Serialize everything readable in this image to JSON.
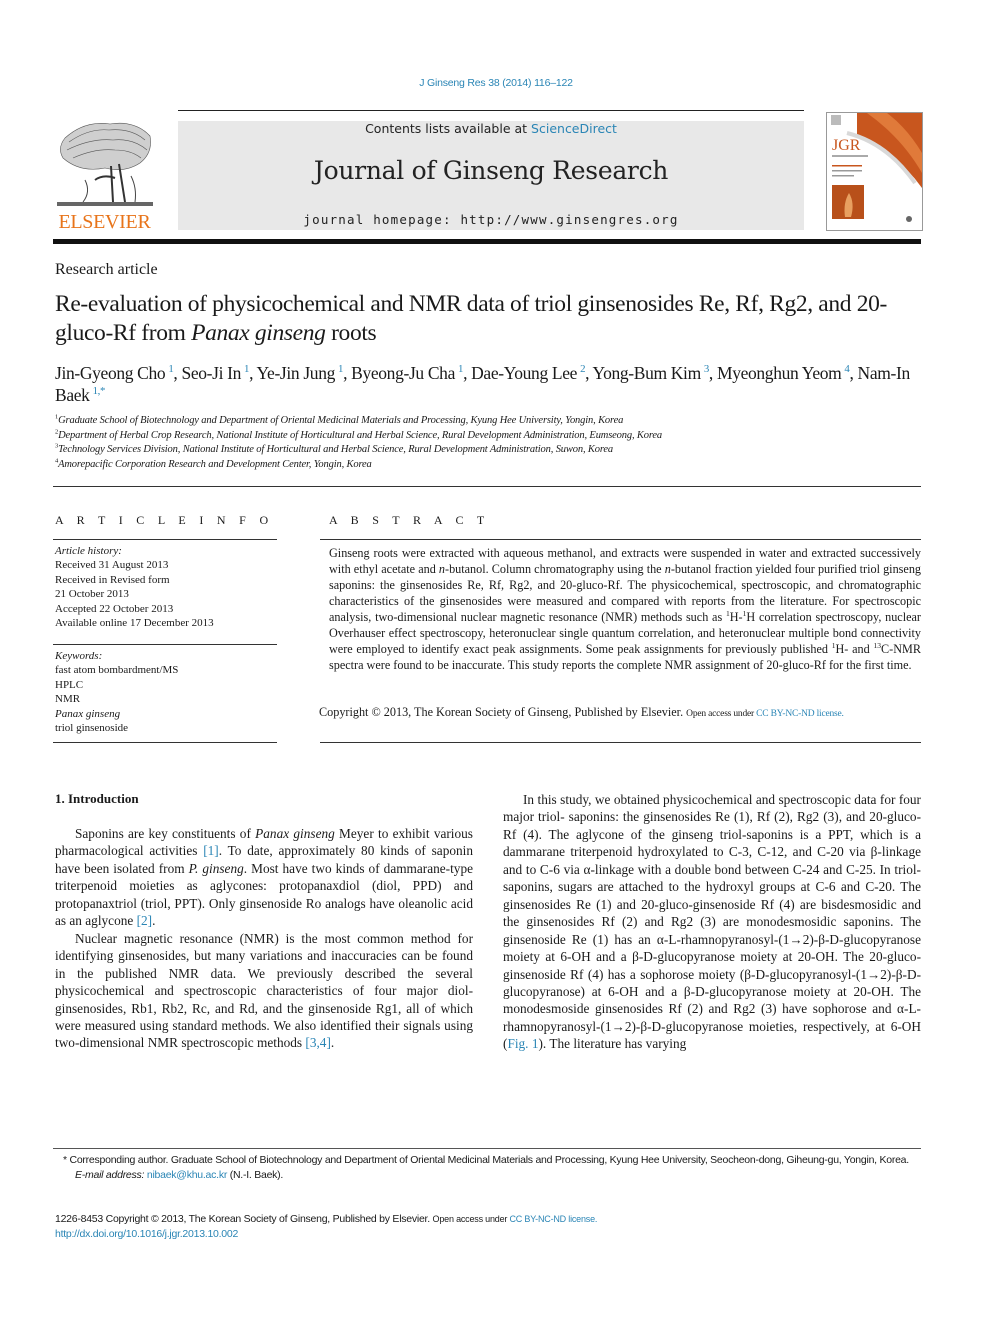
{
  "header": {
    "citation": "J Ginseng Res 38 (2014) 116–122",
    "publisher_logo_text": "ELSEVIER",
    "contents_prefix": "Contents lists available at ",
    "contents_link": "ScienceDirect",
    "journal_title": "Journal of Ginseng Research",
    "homepage_prefix": "journal homepage: ",
    "homepage_url": "http://www.ginsengres.org",
    "cover_label": "JGR",
    "colors": {
      "link": "#2a85b5",
      "elsevier_orange": "#e8741a",
      "banner_bg": "#e8e8e8",
      "cover_orange": "#c8561e"
    }
  },
  "article": {
    "type": "Research article",
    "title_part1": "Re-evaluation of physicochemical and NMR data of triol ginsenosides Re, Rf, Rg2, and 20-gluco-Rf from ",
    "title_italic": "Panax ginseng",
    "title_part2": " roots",
    "authors": [
      {
        "name": "Jin-Gyeong Cho",
        "aff": "1",
        "sep": ", "
      },
      {
        "name": "Seo-Ji In",
        "aff": "1",
        "sep": ", "
      },
      {
        "name": "Ye-Jin Jung",
        "aff": "1",
        "sep": ", "
      },
      {
        "name": "Byeong-Ju Cha",
        "aff": "1",
        "sep": ", "
      },
      {
        "name": "Dae-Young Lee",
        "aff": "2",
        "sep": ", "
      },
      {
        "name": "Yong-Bum Kim",
        "aff": "3",
        "sep": ", "
      },
      {
        "name": "Myeonghun Yeom",
        "aff": "4",
        "sep": ", "
      },
      {
        "name": "Nam-In Baek",
        "aff": "1,*",
        "sep": ""
      }
    ],
    "affiliations": [
      {
        "num": "1",
        "text": "Graduate School of Biotechnology and Department of Oriental Medicinal Materials and Processing, Kyung Hee University, Yongin, Korea"
      },
      {
        "num": "2",
        "text": "Department of Herbal Crop Research, National Institute of Horticultural and Herbal Science, Rural Development Administration, Eumseong, Korea"
      },
      {
        "num": "3",
        "text": "Technology Services Division, National Institute of Horticultural and Herbal Science, Rural Development Administration, Suwon, Korea"
      },
      {
        "num": "4",
        "text": "Amorepacific Corporation Research and Development Center, Yongin, Korea"
      }
    ]
  },
  "article_info": {
    "heading": "A R T I C L E   I N F O",
    "history_label": "Article history:",
    "history": [
      "Received 31 August 2013",
      "Received in Revised form",
      "21 October 2013",
      "Accepted 22 October 2013",
      "Available online 17 December 2013"
    ],
    "keywords_label": "Keywords:",
    "keywords": [
      {
        "text": "fast atom bombardment/MS",
        "italic": false
      },
      {
        "text": "HPLC",
        "italic": false
      },
      {
        "text": "NMR",
        "italic": false
      },
      {
        "text": "Panax ginseng",
        "italic": true
      },
      {
        "text": "triol ginsenoside",
        "italic": false
      }
    ]
  },
  "abstract": {
    "heading": "A B S T R A C T",
    "s1": "Ginseng roots were extracted with aqueous methanol, and extracts were suspended in water and extracted successively with ethyl acetate and ",
    "n1": "n",
    "s2": "-butanol. Column chromatography using the ",
    "n2": "n",
    "s3": "-butanol fraction yielded four purified triol ginseng saponins: the ginsenosides Re, Rf, Rg2, and 20-gluco-Rf. The physicochemical, spectroscopic, and chromatographic characteristics of the ginsenosides were measured and compared with reports from the literature. For spectroscopic analysis, two-dimensional nuclear magnetic resonance (NMR) methods such as ",
    "sup1": "1",
    "s4": "H-",
    "sup2": "1",
    "s5": "H correlation spectroscopy, nuclear Overhauser effect spectroscopy, heteronuclear single quantum correlation, and heteronuclear multiple bond connectivity were employed to identify exact peak assignments. Some peak assignments for previously published ",
    "sup3": "1",
    "s6": "H- and ",
    "sup4": "13",
    "s7": "C-NMR spectra were found to be inaccurate. This study reports the complete NMR assignment of 20-gluco-Rf for the first time.",
    "copyright": "Copyright © 2013, The Korean Society of Ginseng, Published by Elsevier. ",
    "open_access": "Open access under ",
    "license": "CC BY-NC-ND license."
  },
  "body": {
    "section_heading": "1.  Introduction",
    "left": {
      "p1_a": "Saponins are key constituents of ",
      "p1_i1": "Panax ginseng",
      "p1_b": " Meyer to exhibit various pharmacological activities ",
      "p1_ref1": "[1]",
      "p1_c": ". To date, approximately 80 kinds of saponin have been isolated from ",
      "p1_i2": "P. ginseng",
      "p1_d": ". Most have two kinds of dammarane-type triterpenoid moieties as aglycones: protopanaxdiol (diol, PPD) and protopanaxtriol (triol, PPT). Only ginsenoside Ro analogs have oleanolic acid as an aglycone ",
      "p1_ref2": "[2]",
      "p1_e": ".",
      "p2_a": "Nuclear magnetic resonance (NMR) is the most common method for identifying ginsenosides, but many variations and inaccuracies can be found in the published NMR data. We previously described the several physicochemical and spectroscopic characteristics of four major diol-ginsenosides, Rb1, Rb2, Rc, and Rd, and the ginsenoside Rg1, all of which were measured using standard methods. We also identified their signals using two-dimensional NMR spectroscopic methods ",
      "p2_ref": "[3,4]",
      "p2_b": "."
    },
    "right": {
      "p_a": "In this study, we obtained physicochemical and spectroscopic data for four major triol- saponins: the ginsenosides Re (1), Rf (2), Rg2 (3), and 20-gluco-Rf (4). The aglycone of the ginseng triol-saponins is a PPT, which is a dammarane triterpenoid hydroxylated to C-3, C-12, and C-20 via β-linkage and to C-6 via α-linkage with a double bond between C-24 and C-25. In triol-saponins, sugars are attached to the hydroxyl groups at C-6 and C-20. The ginsenosides Re (1) and 20-gluco-ginsenoside Rf (4) are bisdesmosidic and the ginsenosides Rf (2) and Rg2 (3) are monodesmosidic saponins. The ginsenoside Re (1) has an α-L-rhamnopyranosyl-(1→2)-β-D-glucopyranose moiety at 6-OH and a β-D-glucopyranose moiety at 20-OH. The 20-gluco-ginsenoside Rf (4) has a sophorose moiety (β-D-glucopyranosyl-(1→2)-β-D-glucopyranose) at 6-OH and a β-D-glucopyranose moiety at 20-OH. The monodesmoside ginsenosides Rf (2) and Rg2 (3) have sophorose and α-L-rhamnopyranosyl-(1→2)-β-D-glucopyranose moieties, respectively, at 6-OH (",
      "p_ref": "Fig. 1",
      "p_b": "). The literature has varying"
    }
  },
  "footnotes": {
    "corresponding": "* Corresponding author. Graduate School of Biotechnology and Department of Oriental Medicinal Materials and Processing, Kyung Hee University, Seocheon-dong, Giheung-gu, Yongin, Korea.",
    "email_label": "E-mail address: ",
    "email": "nibaek@khu.ac.kr",
    "email_suffix": " (N.-I. Baek).",
    "issn_copyright": "1226-8453 Copyright © 2013, The Korean Society of Ginseng, Published by Elsevier. ",
    "open_access": "Open access under ",
    "license": "CC BY-NC-ND license.",
    "doi": "http://dx.doi.org/10.1016/j.jgr.2013.10.002"
  }
}
